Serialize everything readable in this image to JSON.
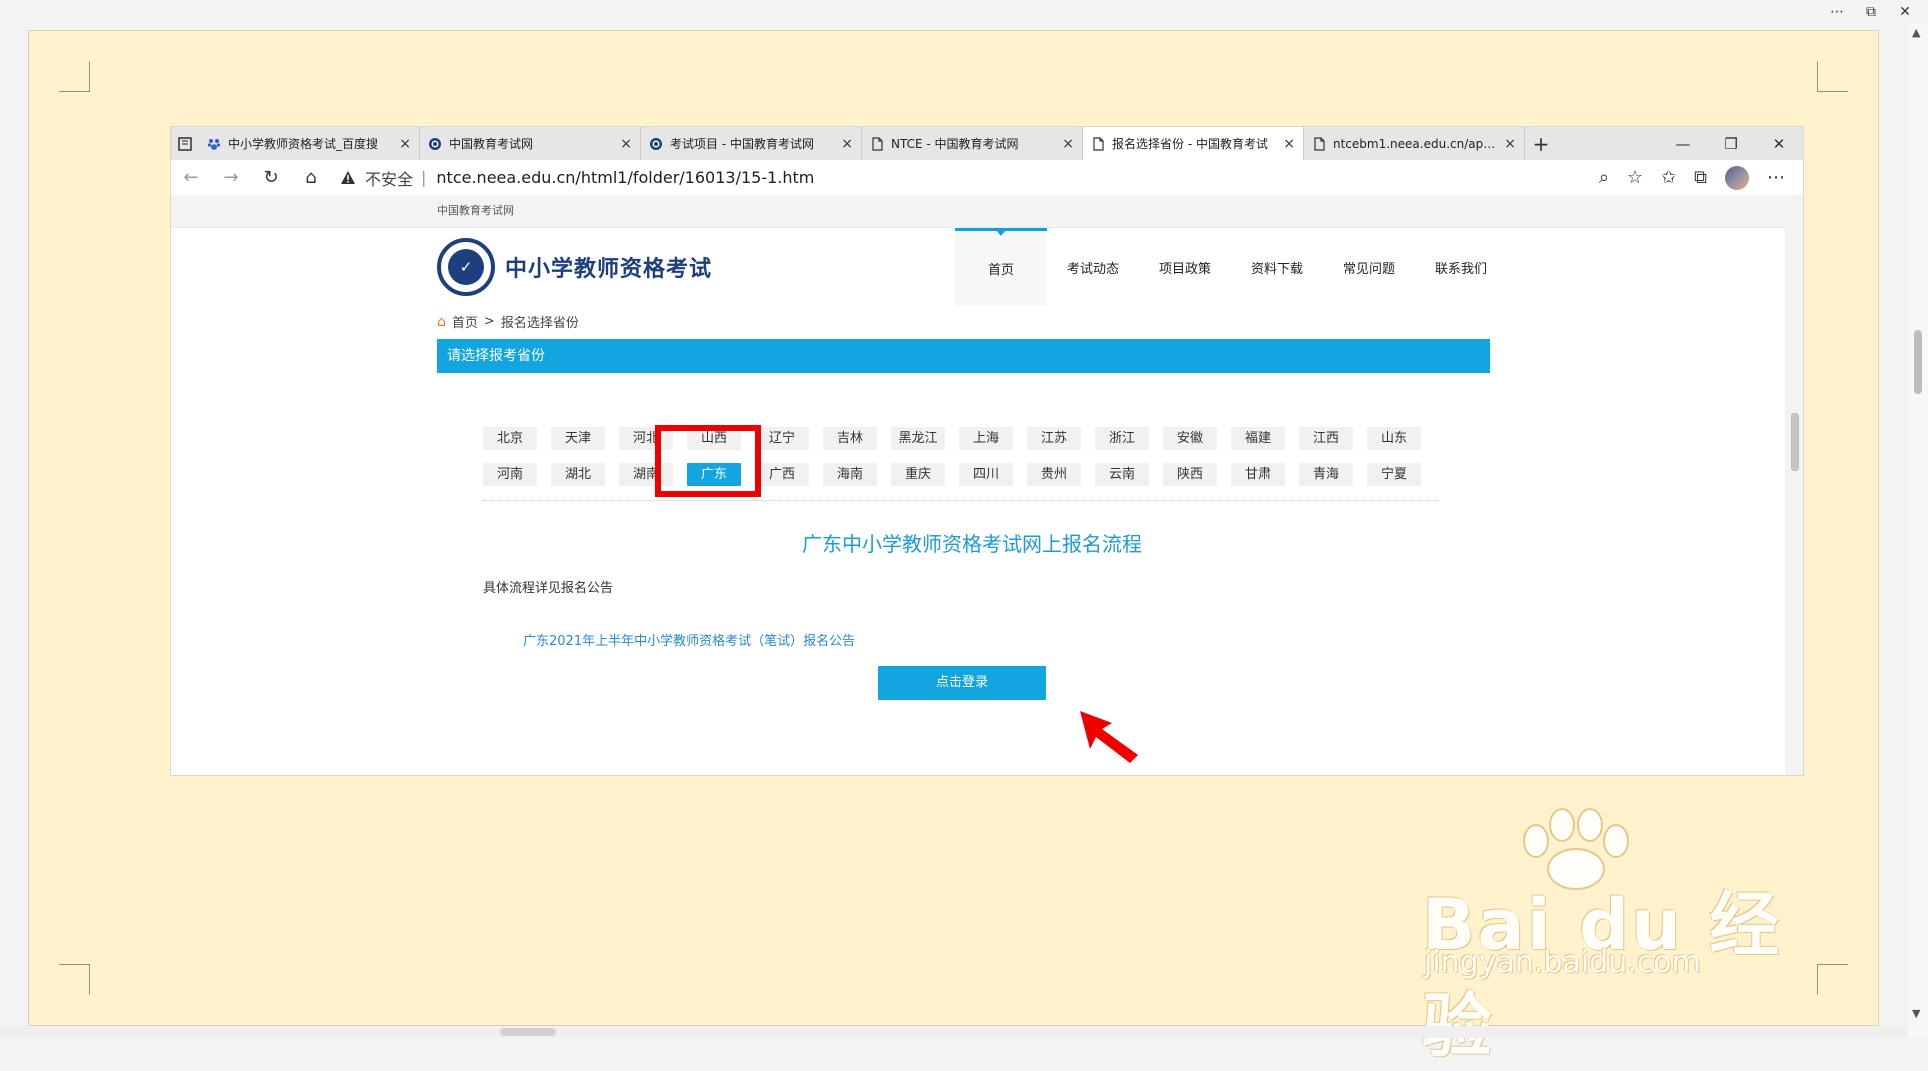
{
  "outer_ui": {
    "more_icon": "more-horizontal-icon",
    "window_icon": "window-icon",
    "close_icon": "close-icon",
    "close_label": "✕"
  },
  "browser": {
    "tabs": [
      {
        "label": "中小学教师资格考试_百度搜",
        "favicon": "baidu-icon"
      },
      {
        "label": "中国教育考试网",
        "favicon": "site-logo-icon"
      },
      {
        "label": "考试项目 - 中国教育考试网",
        "favicon": "site-logo-icon"
      },
      {
        "label": "NTCE - 中国教育考试网",
        "favicon": "page-icon"
      },
      {
        "label": "报名选择省份 - 中国教育考试",
        "favicon": "page-icon",
        "active": true
      },
      {
        "label": "ntcebm1.neea.edu.cn/apply",
        "favicon": "page-icon"
      }
    ],
    "address": {
      "security_label": "不安全",
      "url": "ntce.neea.edu.cn/html1/folder/16013/15-1.htm"
    }
  },
  "site": {
    "top_label": "中国教育考试网",
    "title": "中小学教师资格考试",
    "nav": [
      {
        "label": "首页",
        "active": true
      },
      {
        "label": "考试动态"
      },
      {
        "label": "项目政策"
      },
      {
        "label": "资料下载"
      },
      {
        "label": "常见问题"
      },
      {
        "label": "联系我们"
      }
    ],
    "breadcrumb": {
      "home": "首页",
      "current": "报名选择省份"
    },
    "section_title": "请选择报考省份",
    "provinces_row1": [
      "北京",
      "天津",
      "河北",
      "山西",
      "辽宁",
      "吉林",
      "黑龙江",
      "上海",
      "江苏",
      "浙江",
      "安徽",
      "福建",
      "江西",
      "山东"
    ],
    "provinces_row2": [
      "河南",
      "湖北",
      "湖南",
      "广东",
      "广西",
      "海南",
      "重庆",
      "四川",
      "贵州",
      "云南",
      "陕西",
      "甘肃",
      "青海",
      "宁夏"
    ],
    "selected_province": "广东",
    "process_title": "广东中小学教师资格考试网上报名流程",
    "detail_text": "具体流程详见报名公告",
    "announcement_link": "广东2021年上半年中小学教师资格考试（笔试）报名公告",
    "login_button": "点击登录"
  },
  "watermark": {
    "main": "Bai du 经验",
    "sub": "jingyan.baidu.com"
  }
}
